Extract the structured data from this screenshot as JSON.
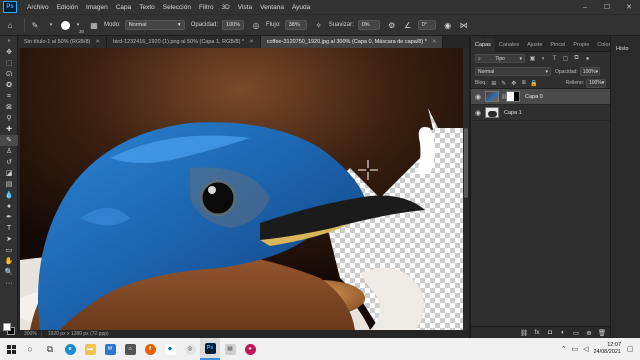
{
  "app": {
    "logo_text": "Ps",
    "menus": [
      "Archivo",
      "Edición",
      "Imagen",
      "Capa",
      "Texto",
      "Selección",
      "Filtro",
      "3D",
      "Vista",
      "Ventana",
      "Ayuda"
    ],
    "window_controls": [
      "–",
      "☐",
      "✕"
    ]
  },
  "options_bar": {
    "brush_size": "30",
    "mode_label": "Modo:",
    "mode_value": "Normal",
    "opacity_label": "Opacidad:",
    "opacity_value": "100%",
    "flow_label": "Flujo:",
    "flow_value": "38%",
    "smoothing_label": "Suavizar:",
    "smoothing_value": "0%",
    "angle_value": "0°"
  },
  "tabs": [
    {
      "label": "Sin título-1 al 50% (RGB/8)",
      "active": false
    },
    {
      "label": "bird-1232416_1920 (1).png al 50% (Capa 1, RGB/8) *",
      "active": false
    },
    {
      "label": "coffee-3120750_1920.jpg al 300% (Capa 0, Máscara de capa/8) *",
      "active": true
    }
  ],
  "status": {
    "zoom": "300%",
    "doc_info": "1920 px x 1280 px (72 ppp)"
  },
  "layers_panel": {
    "tabs": [
      "Capas",
      "Canales",
      "Ajuste",
      "Pincel",
      "Propie",
      "Color"
    ],
    "active_tab": "Capas",
    "filter_value": "Tipo",
    "blend_mode": "Normal",
    "opacity_label": "Opacidad:",
    "opacity_value": "100%",
    "lock_label": "Bloq.:",
    "fill_label": "Relleno:",
    "fill_value": "100%",
    "layers": [
      {
        "name": "Capa 0",
        "selected": true,
        "has_mask": true
      },
      {
        "name": "Capa 1",
        "selected": false,
        "has_mask": false
      }
    ]
  },
  "far_panel": {
    "title": "Histo"
  },
  "taskbar": {
    "time": "12:07",
    "date": "24/08/2021"
  },
  "colors": {
    "accent": "#31a8ff",
    "panel_bg": "#2f2f2f",
    "bird_blue": "#1f6fb8"
  }
}
